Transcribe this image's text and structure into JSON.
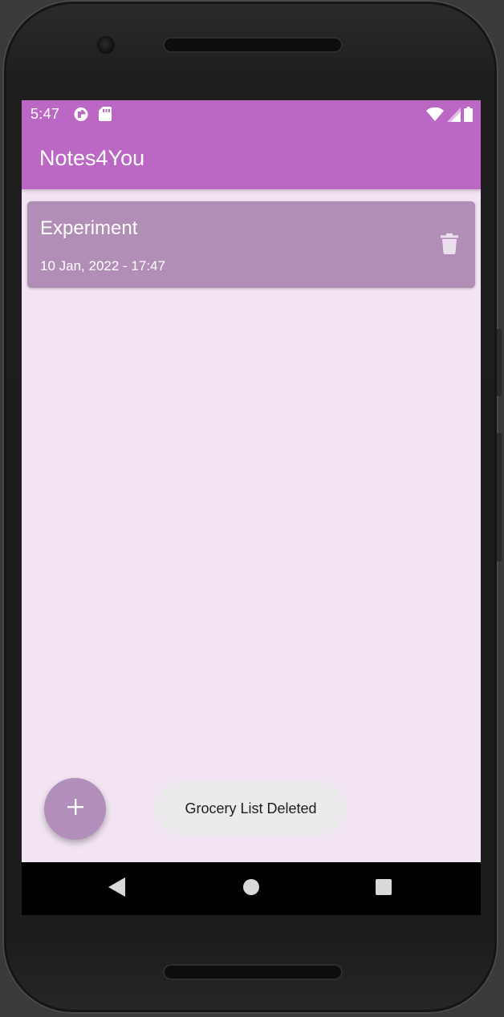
{
  "status_bar": {
    "time": "5:47",
    "left_icons": [
      "data-saver-icon",
      "sd-card-icon"
    ],
    "right_icons": [
      "wifi-icon",
      "cell-signal-icon",
      "battery-icon"
    ]
  },
  "app_bar": {
    "title": "Notes4You"
  },
  "notes": [
    {
      "title": "Experiment",
      "date": "10 Jan, 2022 - 17:47",
      "action_icon": "trash-icon"
    }
  ],
  "fab": {
    "icon": "plus-icon"
  },
  "toast": {
    "message": "Grocery List Deleted"
  },
  "nav_bar": {
    "buttons": [
      "back-icon",
      "home-icon",
      "recents-icon"
    ]
  },
  "colors": {
    "primary": "#bb68c4",
    "background": "#f2e4f2",
    "card": "#b08eb5",
    "fab": "#b28fba",
    "toast": "#edeaee"
  }
}
